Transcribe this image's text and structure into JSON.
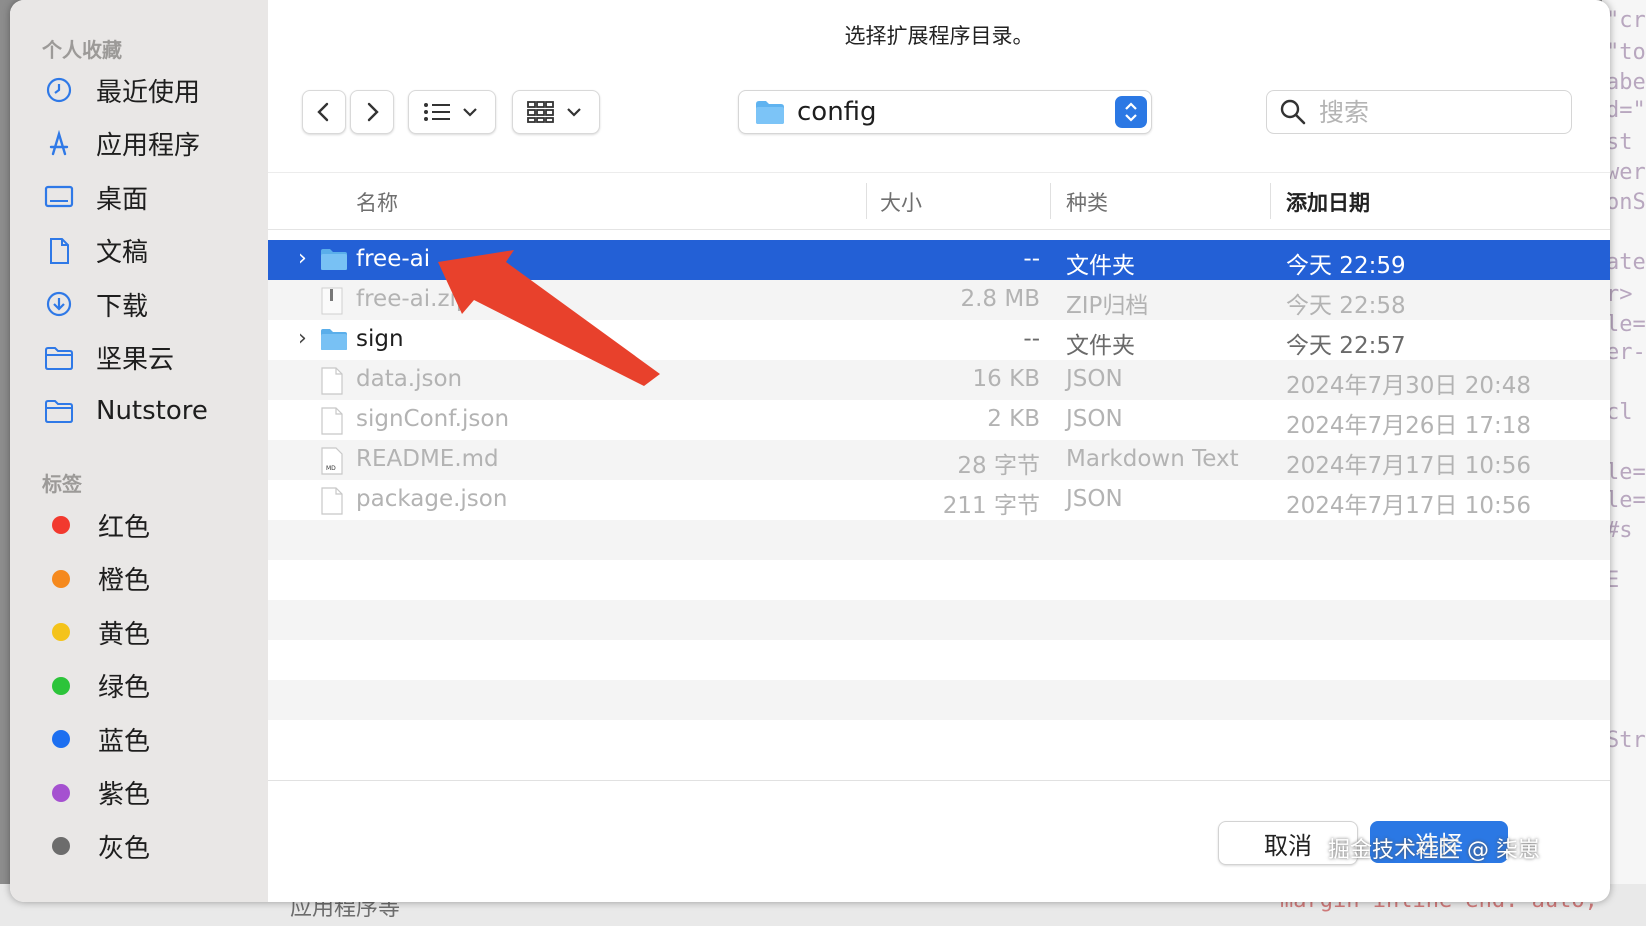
{
  "background": {
    "code_lines": [
      "\"cr",
      "\"to",
      "abe",
      "d=\"",
      "st",
      "wer",
      "onS",
      "ate",
      "r>",
      "le=",
      "er-",
      "cl",
      "le=",
      "le=",
      "#s",
      "E",
      "Str"
    ],
    "bottom_left_text": "应用程序等",
    "bottom_right_text": "margin-inline-end: auto;"
  },
  "dialog": {
    "title": "选择扩展程序目录。",
    "sidebar": {
      "favorites_header": "个人收藏",
      "favorites": [
        {
          "label": "最近使用",
          "icon": "clock-icon"
        },
        {
          "label": "应用程序",
          "icon": "applications-icon"
        },
        {
          "label": "桌面",
          "icon": "desktop-icon"
        },
        {
          "label": "文稿",
          "icon": "document-icon"
        },
        {
          "label": "下载",
          "icon": "download-icon"
        },
        {
          "label": "坚果云",
          "icon": "folder-icon"
        },
        {
          "label": "Nutstore",
          "icon": "folder-icon"
        }
      ],
      "tags_header": "标签",
      "tags": [
        {
          "label": "红色",
          "color": "#f2392e"
        },
        {
          "label": "橙色",
          "color": "#f5891d"
        },
        {
          "label": "黄色",
          "color": "#f4c31a"
        },
        {
          "label": "绿色",
          "color": "#2cc43a"
        },
        {
          "label": "蓝色",
          "color": "#1d6ff0"
        },
        {
          "label": "紫色",
          "color": "#a551d0"
        },
        {
          "label": "灰色",
          "color": "#6c6c6c"
        }
      ]
    },
    "toolbar": {
      "back_icon": "chevron-left-icon",
      "forward_icon": "chevron-right-icon",
      "list_view_icon": "list-icon",
      "grid_view_icon": "grid-icon",
      "path_label": "config",
      "search_placeholder": "搜索"
    },
    "columns": {
      "name": "名称",
      "size": "大小",
      "kind": "种类",
      "date_added": "添加日期"
    },
    "files": [
      {
        "name": "free-ai",
        "size": "--",
        "kind": "文件夹",
        "date": "今天 22:59",
        "type": "folder",
        "selected": true,
        "dim": false
      },
      {
        "name": "free-ai.zip",
        "size": "2.8 MB",
        "kind": "ZIP归档",
        "date": "今天 22:58",
        "type": "zip",
        "selected": false,
        "dim": true
      },
      {
        "name": "sign",
        "size": "--",
        "kind": "文件夹",
        "date": "今天 22:57",
        "type": "folder",
        "selected": false,
        "dim": false
      },
      {
        "name": "data.json",
        "size": "16 KB",
        "kind": "JSON",
        "date": "2024年7月30日 20:48",
        "type": "file",
        "selected": false,
        "dim": true
      },
      {
        "name": "signConf.json",
        "size": "2 KB",
        "kind": "JSON",
        "date": "2024年7月26日 17:18",
        "type": "file",
        "selected": false,
        "dim": true
      },
      {
        "name": "README.md",
        "size": "28 字节",
        "kind": "Markdown Text",
        "date": "2024年7月17日 10:56",
        "type": "md",
        "selected": false,
        "dim": true
      },
      {
        "name": "package.json",
        "size": "211 字节",
        "kind": "JSON",
        "date": "2024年7月17日 10:56",
        "type": "file",
        "selected": false,
        "dim": true
      }
    ],
    "cancel_label": "取消",
    "select_label": "选择",
    "accent_color": "#2b78e4"
  },
  "watermark": "掘金技术社区 @ 柒崽"
}
